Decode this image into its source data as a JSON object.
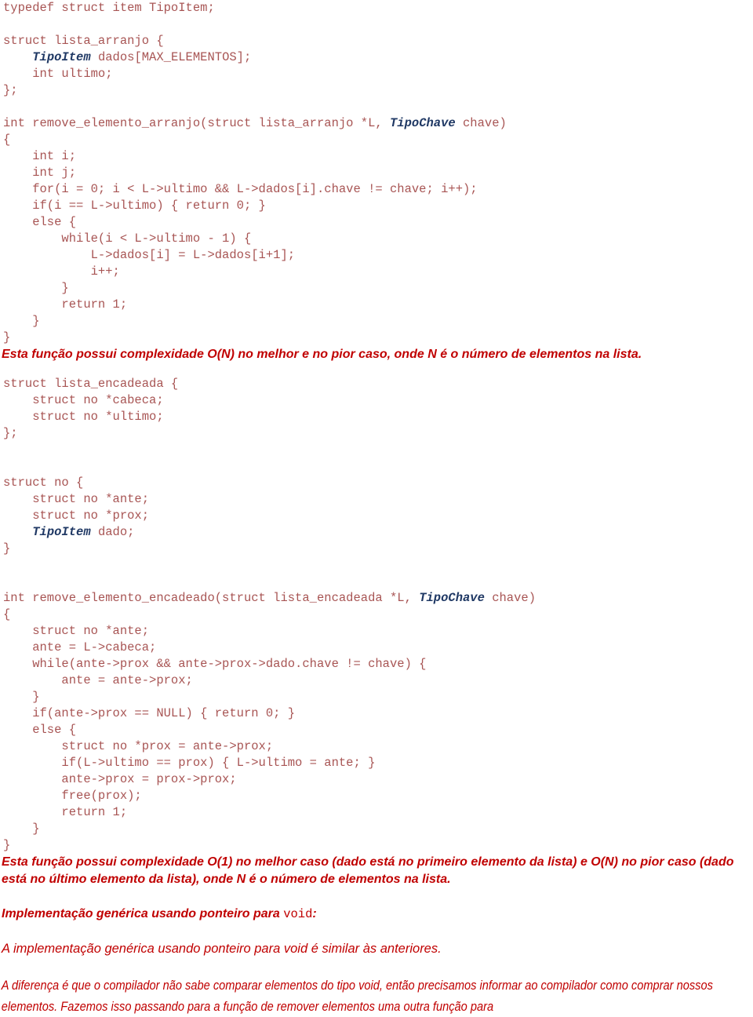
{
  "document": {
    "language": "pt-BR",
    "topic": "Remoção de elementos em listas (arranjo e encadeada)",
    "code_color": "#a85554",
    "highlight_color": "#1f3864",
    "prose_color": "#c00000"
  },
  "blocks": {
    "code_typedef": "typedef struct item TipoItem;",
    "code_struct_arranjo_l1": "struct lista_arranjo {",
    "code_struct_arranjo_l2_type": "TipoItem",
    "code_struct_arranjo_l2_rest": " dados[MAX_ELEMENTOS];",
    "code_struct_arranjo_l3": "    int ultimo;",
    "code_struct_arranjo_l4": "};",
    "code_fn_arranjo_sig_a": "int remove_elemento_arranjo(struct lista_arranjo *L, ",
    "code_fn_arranjo_sig_type": "TipoChave",
    "code_fn_arranjo_sig_b": " chave)",
    "code_fn_arranjo_body": "{\n    int i;\n    int j;\n    for(i = 0; i < L->ultimo && L->dados[i].chave != chave; i++);\n    if(i == L->ultimo) { return 0; }\n    else {\n        while(i < L->ultimo - 1) {\n            L->dados[i] = L->dados[i+1];\n            i++;\n        }\n        return 1;\n    }\n}",
    "prose_arranjo_complexity": "Esta função possui complexidade O(N) no melhor e no pior caso, onde N é o número de elementos na lista.",
    "code_struct_encadeada": "struct lista_encadeada {\n    struct no *cabeca;\n    struct no *ultimo;\n};",
    "code_struct_no_l1": "struct no {",
    "code_struct_no_l2": "    struct no *ante;",
    "code_struct_no_l3": "    struct no *prox;",
    "code_struct_no_l4_type": "TipoItem",
    "code_struct_no_l4_rest": " dado;",
    "code_struct_no_l5": "}",
    "code_fn_encadeado_sig_a": "int remove_elemento_encadeado(struct lista_encadeada *L, ",
    "code_fn_encadeado_sig_type": "TipoChave",
    "code_fn_encadeado_sig_b": " chave)",
    "code_fn_encadeado_body": "{\n    struct no *ante;\n    ante = L->cabeca;\n    while(ante->prox && ante->prox->dado.chave != chave) {\n        ante = ante->prox;\n    }\n    if(ante->prox == NULL) { return 0; }\n    else {\n        struct no *prox = ante->prox;\n        if(L->ultimo == prox) { L->ultimo = ante; }\n        ante->prox = prox->prox;\n        free(prox);\n        return 1;\n    }\n}",
    "prose_encadeado_complexity": "Esta função possui complexidade O(1) no melhor caso (dado está no primeiro elemento da lista) e O(N) no pior caso (dado está no último elemento da lista), onde N é o número de elementos na lista.",
    "heading_generica_a": "Implementação genérica usando ponteiro para ",
    "heading_generica_mono": "void",
    "heading_generica_b": ":",
    "prose_generica_intro": "A implementação genérica usando ponteiro para void é similar às anteriores.",
    "prose_generica_detail": "A diferença é que o compilador não sabe comparar elementos do tipo void, então precisamos informar ao compilador como comprar nossos elementos. Fazemos isso passando para a função de remover elementos uma outra função para"
  }
}
